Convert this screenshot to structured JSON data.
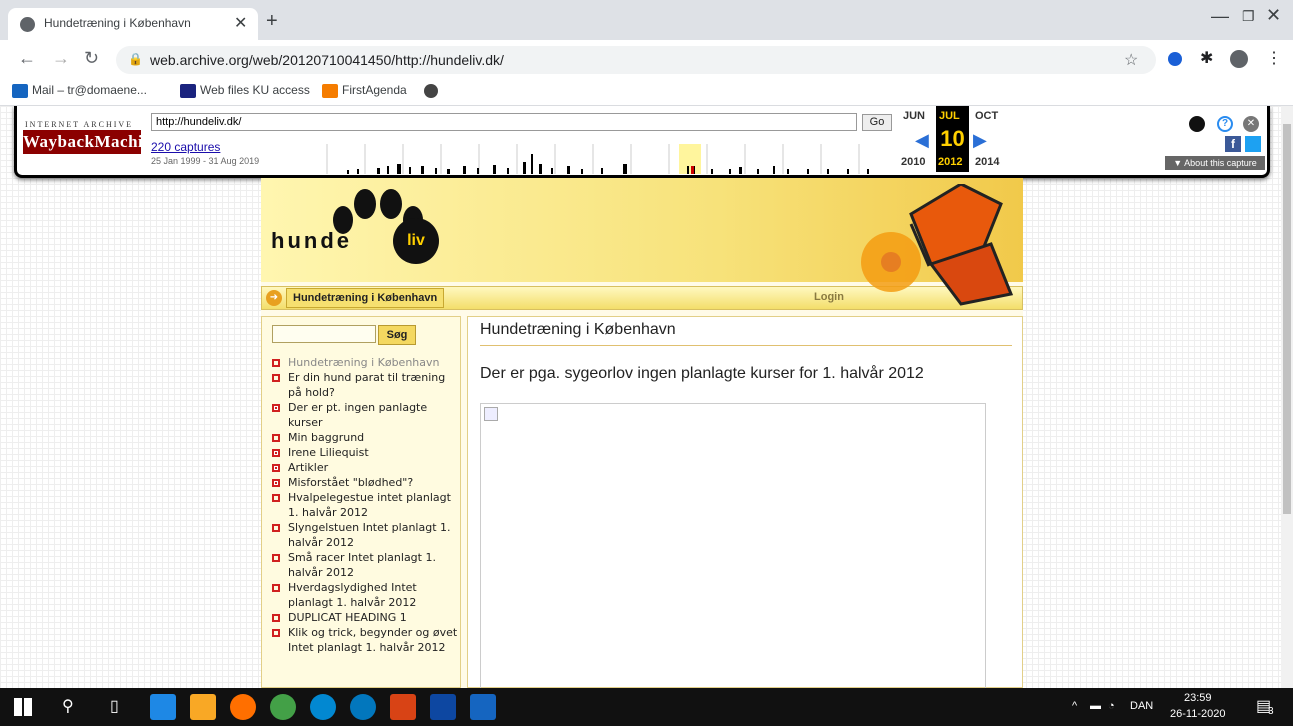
{
  "browser": {
    "tab_title": "Hundetræning i København",
    "url": "web.archive.org/web/20120710041450/http://hundeliv.dk/",
    "bookmarks": [
      {
        "label": "Mail – tr@domaene...",
        "icon": "outlook-icon",
        "color": "#1565c0"
      },
      {
        "label": "Web files KU access",
        "icon": "ku-icon",
        "color": "#1a237e"
      },
      {
        "label": "FirstAgenda",
        "icon": "firstagenda-icon",
        "color": "#f57c00"
      }
    ]
  },
  "wayback": {
    "org_label": "INTERNET ARCHIVE",
    "logo_text": "WaybackMachine",
    "url_value": "http://hundeliv.dk/",
    "go_label": "Go",
    "captures": "220 captures",
    "range": "25 Jan 1999 - 31 Aug 2019",
    "months": [
      "JUN",
      "JUL",
      "OCT"
    ],
    "day": "10",
    "years": [
      "2010",
      "2012",
      "2014"
    ],
    "about": "▼ About this capture"
  },
  "site": {
    "brand": "hunde",
    "brand_badge": "liv",
    "nav_current": "Hundetræning i København",
    "nav_login": "Login",
    "search_button": "Søg",
    "menu": [
      "Hundetræning i København",
      "",
      "Er din hund parat til træning på hold?",
      "Der er pt. ingen panlagte kurser",
      "Min baggrund",
      "Irene Liliequist",
      "Artikler",
      "Misforstået \"blødhed\"?",
      "Hvalpelegestue intet planlagt 1. halvår 2012",
      "Slyngelstuen Intet planlagt 1. halvår 2012",
      "Små racer Intet planlagt 1. halvår 2012",
      "Hverdagslydighed Intet planlagt 1. halvår 2012",
      "DUPLICAT HEADING 1",
      "Klik og trick, begynder og øvet Intet planlagt 1. halvår 2012"
    ],
    "page_heading": "Hundetræning i København",
    "body_text": "Der er pga. sygeorlov ingen planlagte kurser for 1. halvår 2012"
  },
  "taskbar": {
    "language": "DAN",
    "time": "23:59",
    "date": "26-11-2020",
    "notifications": "3"
  }
}
